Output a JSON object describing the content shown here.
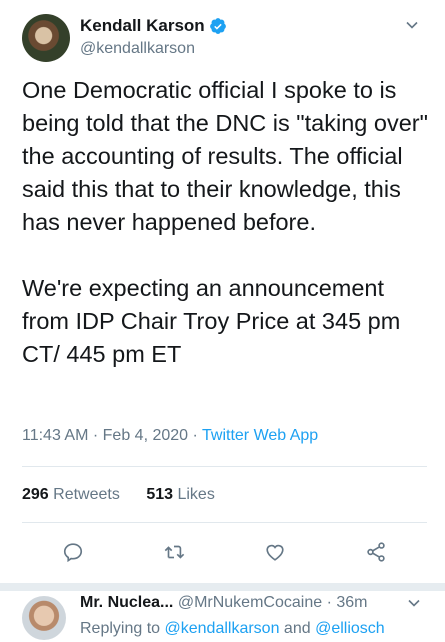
{
  "author": {
    "display_name": "Kendall Karson",
    "handle": "@kendallkarson",
    "verified_icon": "verified-badge-icon"
  },
  "tweet": {
    "text": "One Democratic official I spoke to is being told that the DNC is \"taking over\" the accounting of results. The official said this that to their knowledge, this has never happened before.\n\nWe're expecting an announcement from IDP Chair Troy Price at 345 pm CT/ 445 pm ET",
    "time": "11:43 AM",
    "date": "Feb 4, 2020",
    "source": "Twitter Web App"
  },
  "stats": {
    "retweets_count": "296",
    "retweets_label": "Retweets",
    "likes_count": "513",
    "likes_label": "Likes"
  },
  "actions": [
    "reply-icon",
    "retweet-icon",
    "like-icon",
    "share-icon"
  ],
  "reply": {
    "display_name": "Mr. Nuclea...",
    "handle": "@MrNukemCocaine",
    "age": "36m",
    "replying_prefix": "Replying to",
    "mention_1": "@kendallkarson",
    "and_word": "and",
    "mention_2": "@elliosch"
  },
  "colors": {
    "accent": "#1da1f2",
    "secondary_text": "#657786",
    "primary_text": "#14171a"
  }
}
